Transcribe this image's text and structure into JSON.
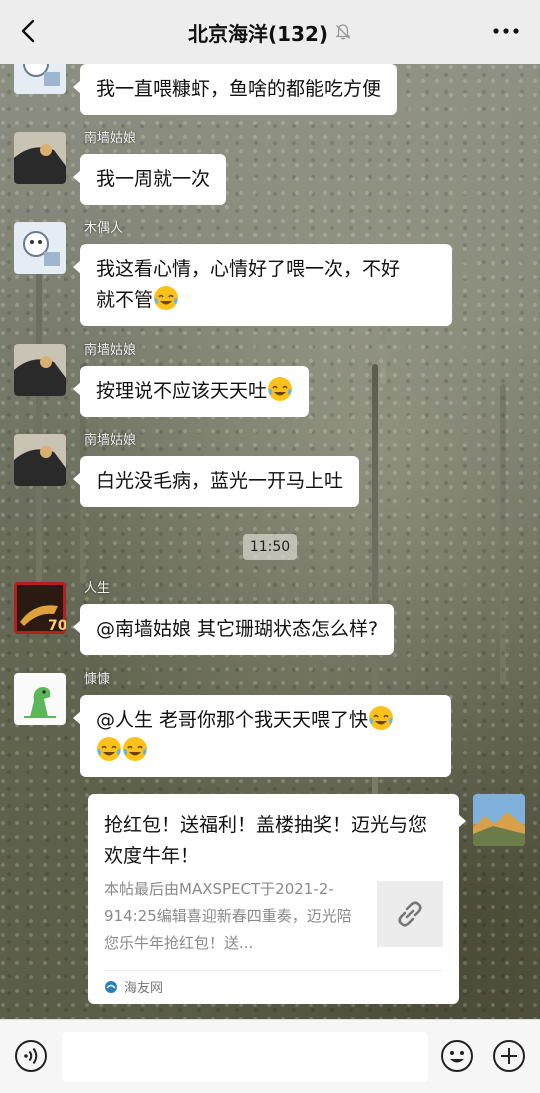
{
  "header": {
    "title": "北京海洋(132)",
    "back_icon": "chevron-left-icon",
    "mute_icon": "bell-muted-icon",
    "more_icon": "ellipsis-icon"
  },
  "messages": [
    {
      "sender": "",
      "text": "我一直喂糠虾，鱼啥的都能吃方便"
    },
    {
      "sender": "南墙姑娘",
      "text": "我一周就一次"
    },
    {
      "sender": "木偶人",
      "text_line1": "我这看心情，心情好了喂一次，不好",
      "text_line2": "就不管"
    },
    {
      "sender": "南墙姑娘",
      "text": "按理说不应该天天吐"
    },
    {
      "sender": "南墙姑娘",
      "text": "白光没毛病，蓝光一开马上吐"
    },
    {
      "sender": "人生",
      "text": "@南墙姑娘  其它珊瑚状态怎么样?"
    },
    {
      "sender": "慷慷",
      "text": "@人生  老哥你那个我天天喂了快"
    }
  ],
  "timestamp": "11:50",
  "link_card": {
    "title": "抢红包！送福利！盖楼抽奖！迈光与您欢度牛年！",
    "desc": "本帖最后由MAXSPECT于2021-2-914:25编辑喜迎新春四重奏，迈光陪您乐牛年抢红包！送...",
    "source": "海友网",
    "thumb_icon": "link-icon"
  },
  "colors": {
    "topbar_bg": "#ededed",
    "bubble_bg": "#ffffff",
    "bottombar_bg": "#f6f6f6"
  }
}
